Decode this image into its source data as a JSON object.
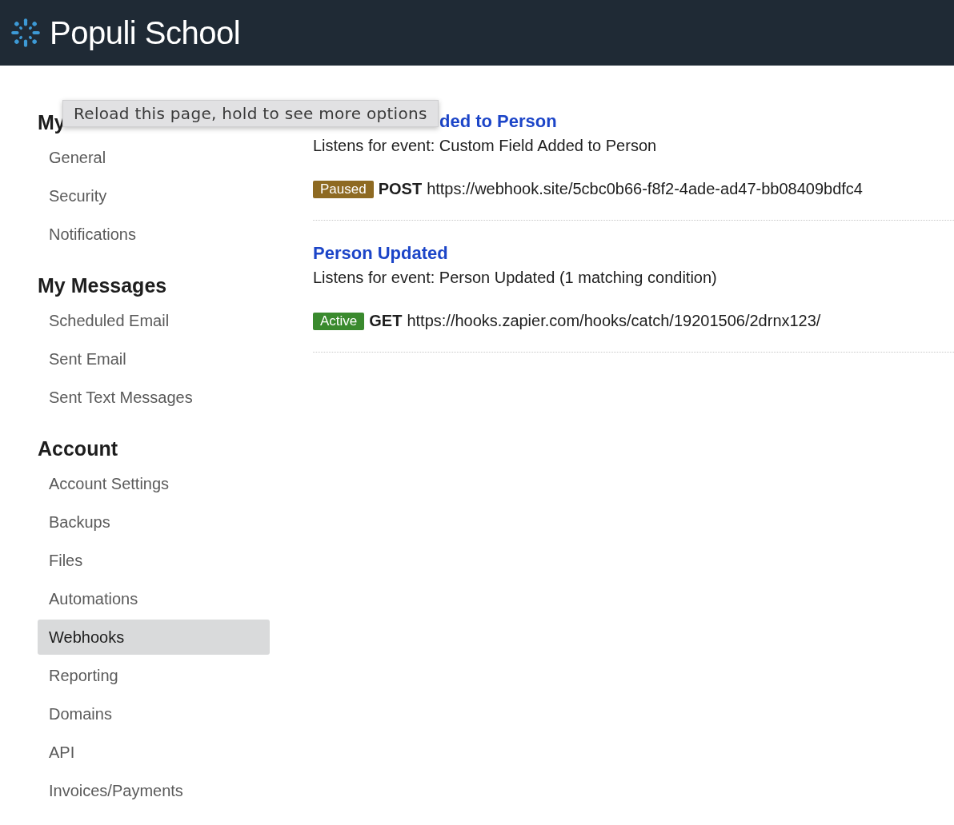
{
  "header": {
    "title": "Populi School"
  },
  "tooltip": {
    "text": "Reload this page, hold to see more options"
  },
  "sidebar": {
    "sections": [
      {
        "heading": "My",
        "items": [
          {
            "label": "General",
            "selected": false
          },
          {
            "label": "Security",
            "selected": false
          },
          {
            "label": "Notifications",
            "selected": false
          }
        ]
      },
      {
        "heading": "My Messages",
        "items": [
          {
            "label": "Scheduled Email",
            "selected": false
          },
          {
            "label": "Sent Email",
            "selected": false
          },
          {
            "label": "Sent Text Messages",
            "selected": false
          }
        ]
      },
      {
        "heading": "Account",
        "items": [
          {
            "label": "Account Settings",
            "selected": false
          },
          {
            "label": "Backups",
            "selected": false
          },
          {
            "label": "Files",
            "selected": false
          },
          {
            "label": "Automations",
            "selected": false
          },
          {
            "label": "Webhooks",
            "selected": true
          },
          {
            "label": "Reporting",
            "selected": false
          },
          {
            "label": "Domains",
            "selected": false
          },
          {
            "label": "API",
            "selected": false
          },
          {
            "label": "Invoices/Payments",
            "selected": false
          }
        ]
      }
    ]
  },
  "webhooks": [
    {
      "title": "ded to Person",
      "covered": true,
      "description": "Listens for event: Custom Field Added to Person",
      "status": "Paused",
      "kind": "paused",
      "method": "POST",
      "url": "https://webhook.site/5cbc0b66-f8f2-4ade-ad47-bb08409bdfc4"
    },
    {
      "title": "Person Updated",
      "covered": false,
      "description": "Listens for event: Person Updated (1 matching condition)",
      "status": "Active",
      "kind": "active",
      "method": "GET",
      "url": "https://hooks.zapier.com/hooks/catch/19201506/2drnx123/"
    }
  ]
}
